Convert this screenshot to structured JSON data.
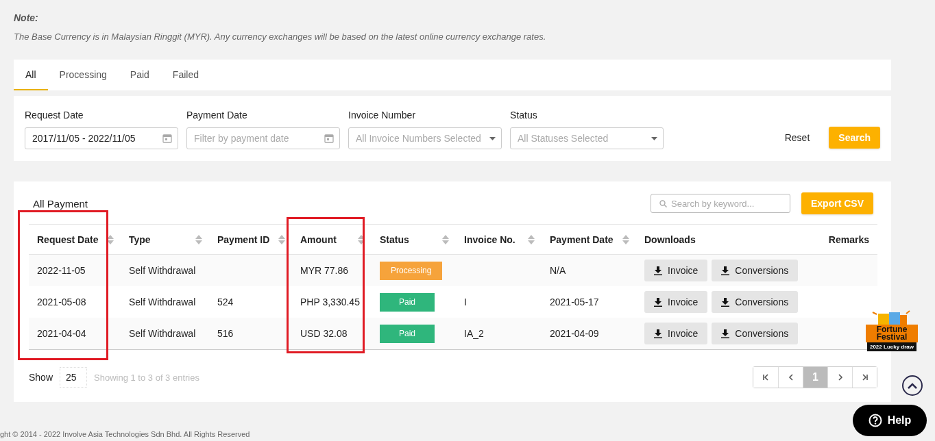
{
  "note": {
    "title": "Note:",
    "text": "The Base Currency is in Malaysian Ringgit (MYR). Any currency exchanges will be based on the latest online currency exchange rates."
  },
  "tabs": [
    {
      "label": "All",
      "selected": true
    },
    {
      "label": "Processing",
      "selected": false
    },
    {
      "label": "Paid",
      "selected": false
    },
    {
      "label": "Failed",
      "selected": false
    }
  ],
  "filters": [
    {
      "label": "Request Date",
      "kind": "date",
      "value": "2017/11/05 - 2022/11/05"
    },
    {
      "label": "Payment Date",
      "kind": "date",
      "placeholder": "Filter by payment date"
    },
    {
      "label": "Invoice Number",
      "kind": "select",
      "placeholder": "All Invoice Numbers Selected"
    },
    {
      "label": "Status",
      "kind": "select",
      "placeholder": "All Statuses Selected"
    }
  ],
  "filter_buttons": {
    "reset": "Reset",
    "search": "Search"
  },
  "table": {
    "title": "All Payment",
    "search_placeholder": "Search by keyword...",
    "export": "Export CSV",
    "columns": [
      {
        "label": "Request Date",
        "sortable": true,
        "highlighted": true
      },
      {
        "label": "Type",
        "sortable": true,
        "highlighted": false
      },
      {
        "label": "Payment ID",
        "sortable": true,
        "highlighted": false
      },
      {
        "label": "Amount",
        "sortable": true,
        "highlighted": true
      },
      {
        "label": "Status",
        "sortable": true,
        "highlighted": false
      },
      {
        "label": "Invoice No.",
        "sortable": true,
        "highlighted": false
      },
      {
        "label": "Payment Date",
        "sortable": true,
        "highlighted": false
      },
      {
        "label": "Downloads",
        "sortable": false,
        "highlighted": false
      },
      {
        "label": "Remarks",
        "sortable": false,
        "highlighted": false
      }
    ],
    "rows": [
      {
        "request_date": "2022-11-05",
        "type": "Self Withdrawal",
        "amount": "MYR 77.86",
        "status": {
          "label": "Processing",
          "color": "#f6a33b"
        },
        "payment_date": "N/A",
        "downloads": [
          "Invoice",
          "Conversions"
        ]
      },
      {
        "request_date": "2021-05-08",
        "type": "Self Withdrawal",
        "payment_id": "524",
        "amount": "PHP 3,330.45",
        "status": {
          "label": "Paid",
          "color": "#2fb67c"
        },
        "invoice_no": "I",
        "payment_date": "2021-05-17",
        "downloads": [
          "Invoice",
          "Conversions"
        ]
      },
      {
        "request_date": "2021-04-04",
        "type": "Self Withdrawal",
        "payment_id": "516",
        "amount": "USD 32.08",
        "status": {
          "label": "Paid",
          "color": "#2fb67c"
        },
        "invoice_no": "IA_2",
        "payment_date": "2021-04-09",
        "downloads": [
          "Invoice",
          "Conversions"
        ]
      }
    ]
  },
  "footer_table": {
    "show_label": "Show",
    "page_size": "25",
    "entries": "Showing 1 to 3 of 3 entries",
    "pages": [
      {
        "label": "1",
        "selected": true
      }
    ]
  },
  "promo": {
    "title": "Fortune Festival",
    "subtitle": "2022 Lucky draw"
  },
  "help": "Help",
  "copyright": "ght © 2014 - 2022 Involve Asia Technologies Sdn Bhd. All Rights Reserved"
}
